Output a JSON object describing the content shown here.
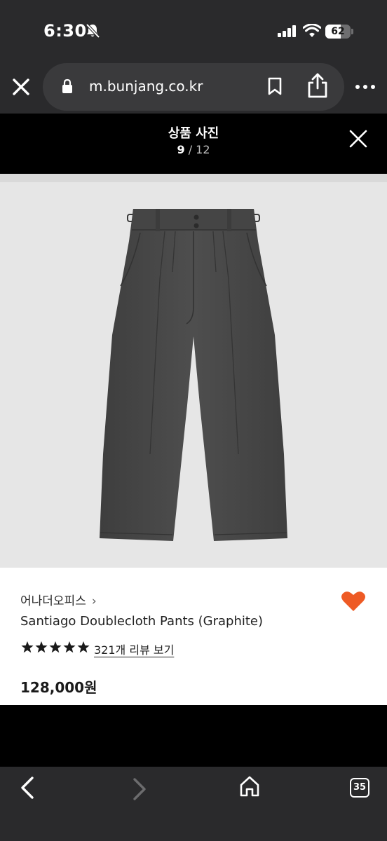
{
  "status_bar": {
    "time": "6:30",
    "battery_percent": "62",
    "battery_level": 0.62,
    "icons": [
      "bell-slash-icon",
      "signal-icon",
      "wifi-icon",
      "battery-icon"
    ]
  },
  "browser": {
    "url": "m.bunjang.co.kr",
    "icons": [
      "close-icon",
      "lock-icon",
      "bookmark-icon",
      "share-icon",
      "more-icon"
    ]
  },
  "gallery": {
    "title": "상품 사진",
    "current": "9",
    "separator": " / ",
    "total": "12"
  },
  "product": {
    "brand": "어나더오피스",
    "brand_chevron": "›",
    "name": "Santiago Doublecloth Pants (Graphite)",
    "rating_stars": 5,
    "reviews_label": "321개 리뷰 보기",
    "price": "128,000원",
    "favorite_color": "#ee5a24"
  },
  "bottom_nav": {
    "tab_count": "35",
    "icons": [
      "back-arrow-icon",
      "forward-arrow-icon",
      "home-icon",
      "tabs-icon"
    ]
  },
  "colors": {
    "chrome_bg": "#2a2a2c",
    "url_pill": "#3a3a3c",
    "photo_bg": "#e6e6e6",
    "pants": "#4a4a4a",
    "accent": "#ee5a24"
  }
}
